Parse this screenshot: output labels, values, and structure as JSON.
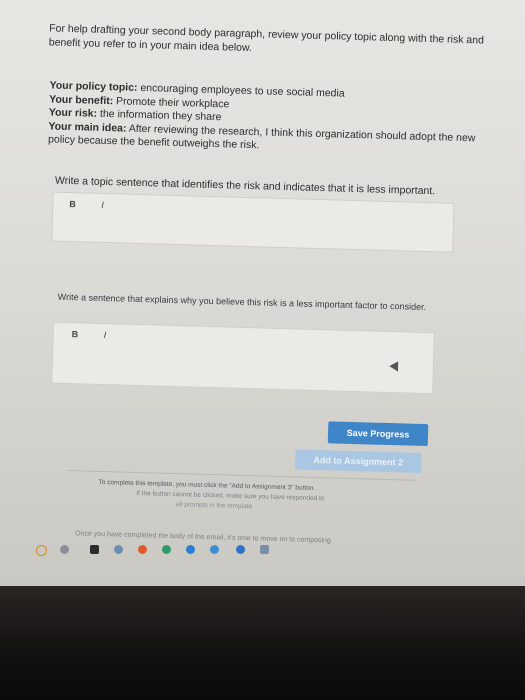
{
  "intro": "For help drafting your second body paragraph, review your policy topic along with the risk and benefit you refer to in your main idea below.",
  "policy": {
    "topic_label": "Your policy topic:",
    "topic_value": "encouraging employees to use social media",
    "benefit_label": "Your benefit:",
    "benefit_value": "Promote their workplace",
    "risk_label": "Your risk:",
    "risk_value": "the information they share",
    "main_idea_label": "Your main idea:",
    "main_idea_value": "After reviewing the research, I think this organization should adopt the new policy because the benefit outweighs the risk."
  },
  "prompt1": "Write a topic sentence that identifies the risk and indicates that it is less important.",
  "prompt2": "Write a sentence that explains why you believe this risk is a less important factor to consider.",
  "toolbar": {
    "bold": "B",
    "italic": "I"
  },
  "buttons": {
    "save": "Save Progress",
    "add": "Add to Assignment 2"
  },
  "footer": {
    "line1": "To complete this template, you must click the \"Add to Assignment 3\" button.",
    "line2": "If the button cannot be clicked, make sure you have responded to",
    "line3": "all prompts in the template.",
    "once": "Once you have completed the body of the email, it's time to move on to composing"
  },
  "colors": {
    "save_button": "#3f86c8",
    "add_button_disabled": "#a9c6e2"
  }
}
